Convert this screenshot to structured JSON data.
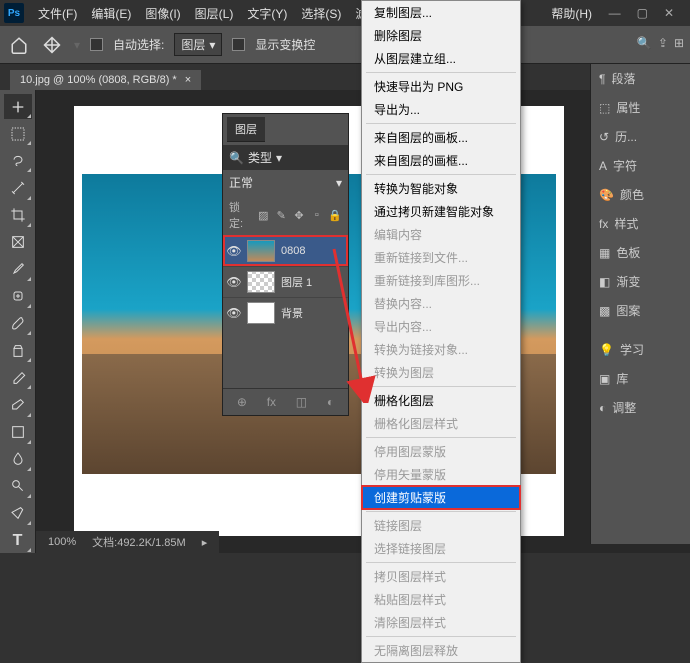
{
  "titlebar": {
    "app_logo": "Ps"
  },
  "menubar": {
    "items": [
      "文件(F)",
      "编辑(E)",
      "图像(I)",
      "图层(L)",
      "文字(Y)",
      "选择(S)",
      "滤",
      "帮助(H)"
    ]
  },
  "options_bar": {
    "auto_select_label": "自动选择:",
    "target_dropdown": "图层",
    "show_transform_label": "显示变换控"
  },
  "document_tab": {
    "title": "10.jpg @ 100% (0808, RGB/8) *"
  },
  "right_panels": {
    "items": [
      "段落",
      "属性",
      "历...",
      "字符",
      "颜色",
      "样式",
      "色板",
      "渐变",
      "图案",
      "学习",
      "库",
      "调整"
    ]
  },
  "layers_panel": {
    "title": "图层",
    "filter_label": "类型",
    "blend_mode": "正常",
    "lock_label": "锁定:",
    "layers": [
      {
        "name": "0808"
      },
      {
        "name": "图层 1"
      },
      {
        "name": "背景"
      }
    ]
  },
  "context_menu": {
    "items": [
      {
        "label": "复制图层...",
        "type": "item"
      },
      {
        "label": "删除图层",
        "type": "item"
      },
      {
        "label": "从图层建立组...",
        "type": "item"
      },
      {
        "type": "sep"
      },
      {
        "label": "快速导出为 PNG",
        "type": "item"
      },
      {
        "label": "导出为...",
        "type": "item"
      },
      {
        "type": "sep"
      },
      {
        "label": "来自图层的画板...",
        "type": "item"
      },
      {
        "label": "来自图层的画框...",
        "type": "item"
      },
      {
        "type": "sep"
      },
      {
        "label": "转换为智能对象",
        "type": "item"
      },
      {
        "label": "通过拷贝新建智能对象",
        "type": "item"
      },
      {
        "label": "编辑内容",
        "type": "disabled"
      },
      {
        "label": "重新链接到文件...",
        "type": "disabled"
      },
      {
        "label": "重新链接到库图形...",
        "type": "disabled"
      },
      {
        "label": "替换内容...",
        "type": "disabled"
      },
      {
        "label": "导出内容...",
        "type": "disabled"
      },
      {
        "label": "转换为链接对象...",
        "type": "disabled"
      },
      {
        "label": "转换为图层",
        "type": "disabled"
      },
      {
        "type": "sep"
      },
      {
        "label": "栅格化图层",
        "type": "item"
      },
      {
        "label": "栅格化图层样式",
        "type": "disabled"
      },
      {
        "type": "sep"
      },
      {
        "label": "停用图层蒙版",
        "type": "disabled"
      },
      {
        "label": "停用矢量蒙版",
        "type": "disabled"
      },
      {
        "label": "创建剪贴蒙版",
        "type": "highlighted"
      },
      {
        "type": "sep"
      },
      {
        "label": "链接图层",
        "type": "disabled"
      },
      {
        "label": "选择链接图层",
        "type": "disabled"
      },
      {
        "type": "sep"
      },
      {
        "label": "拷贝图层样式",
        "type": "disabled"
      },
      {
        "label": "粘贴图层样式",
        "type": "disabled"
      },
      {
        "label": "清除图层样式",
        "type": "disabled"
      },
      {
        "type": "sep"
      },
      {
        "label": "无隔离图层释放",
        "type": "disabled"
      }
    ]
  },
  "status_bar": {
    "zoom": "100%",
    "info": "文档:492.2K/1.85M"
  }
}
